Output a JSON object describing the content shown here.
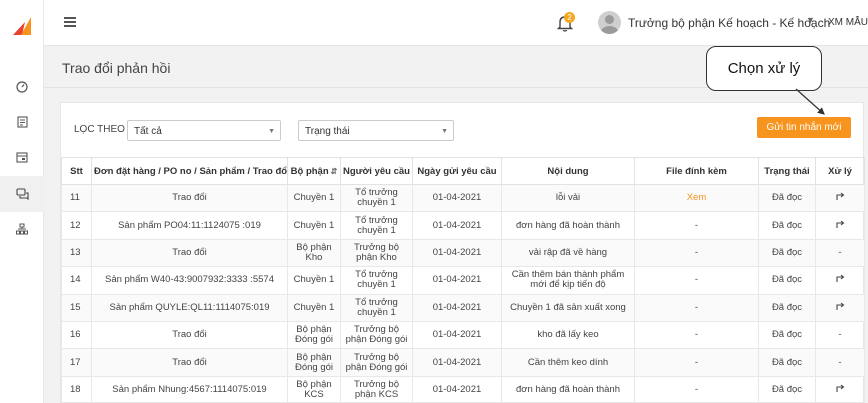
{
  "header": {
    "notification_count": "2",
    "username": "Trưởng bộ phận Kế hoạch - Kế hoạch",
    "store": "XM MẪU"
  },
  "page": {
    "title": "Trao đổi phản hồi"
  },
  "callout": {
    "text": "Chọn xử lý"
  },
  "filters": {
    "label": "LỌC THEO",
    "category_value": "Tất cả",
    "status_value": "Trạng thái"
  },
  "send_button": "Gửi tin nhắn mới",
  "table": {
    "columns": [
      "Stt",
      "Đơn đặt hàng / PO no / Sản phẩm / Trao đổi",
      "Bộ phận",
      "Người yêu cầu",
      "Ngày gửi yêu cầu",
      "Nội dung",
      "File đính kèm",
      "Trạng thái",
      "Xử lý"
    ],
    "rows": [
      {
        "stt": "11",
        "ref": "Trao đổi",
        "dept": "Chuyền 1",
        "requester": "Tổ trưởng chuyền 1",
        "date": "01-04-2021",
        "content": "lỗi vải",
        "file": "Xem",
        "status": "Đã đọc",
        "action": "reply"
      },
      {
        "stt": "12",
        "ref": "Sản phẩm PO04:11:1124075 :019",
        "dept": "Chuyền 1",
        "requester": "Tổ trưởng chuyền 1",
        "date": "01-04-2021",
        "content": "đơn hàng đã hoàn thành",
        "file": "-",
        "status": "Đã đọc",
        "action": "reply"
      },
      {
        "stt": "13",
        "ref": "Trao đổi",
        "dept": "Bộ phận Kho",
        "requester": "Trưởng bộ phận Kho",
        "date": "01-04-2021",
        "content": "vải rập đã về hàng",
        "file": "-",
        "status": "Đã đọc",
        "action": "-"
      },
      {
        "stt": "14",
        "ref": "Sản phẩm W40-43:9007932:3333 :5574",
        "dept": "Chuyền 1",
        "requester": "Tổ trưởng chuyền 1",
        "date": "01-04-2021",
        "content": "Cần thêm bán thành phẩm mới để kịp tiến độ",
        "file": "-",
        "status": "Đã đọc",
        "action": "reply"
      },
      {
        "stt": "15",
        "ref": "Sản phẩm QUYLE:QL11:1114075:019",
        "dept": "Chuyền 1",
        "requester": "Tổ trưởng chuyền 1",
        "date": "01-04-2021",
        "content": "Chuyền 1 đã sản xuất xong",
        "file": "-",
        "status": "Đã đọc",
        "action": "reply"
      },
      {
        "stt": "16",
        "ref": "Trao đổi",
        "dept": "Bộ phận Đóng gói",
        "requester": "Trưởng bộ phận Đóng gói",
        "date": "01-04-2021",
        "content": "kho đã lấy keo",
        "file": "-",
        "status": "Đã đọc",
        "action": "-"
      },
      {
        "stt": "17",
        "ref": "Trao đổi",
        "dept": "Bộ phận Đóng gói",
        "requester": "Trưởng bộ phận Đóng gói",
        "date": "01-04-2021",
        "content": "Cần thêm keo dính",
        "file": "-",
        "status": "Đã đọc",
        "action": "-"
      },
      {
        "stt": "18",
        "ref": "Sản phẩm Nhung:4567:1114075:019",
        "dept": "Bộ phận KCS",
        "requester": "Trưởng bộ phận KCS",
        "date": "01-04-2021",
        "content": "đơn hàng đã hoàn thành",
        "file": "-",
        "status": "Đã đọc",
        "action": "reply"
      }
    ]
  },
  "icons": {
    "sidebar": [
      "dashboard-icon",
      "clipboard-icon",
      "calendar-icon",
      "chat-icon",
      "org-chart-icon"
    ],
    "reply": "reply-arrow-icon"
  },
  "colors": {
    "accent": "#f7941d",
    "logo_orange": "#f7941d",
    "logo_red": "#e8432c"
  }
}
